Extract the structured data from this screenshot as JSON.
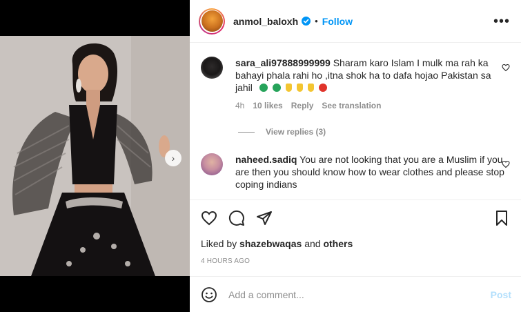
{
  "post": {
    "username": "anmol_baloxh",
    "separator": "•",
    "follow_label": "Follow",
    "more_icon": "more-horizontal-icon",
    "carousel": {
      "slide_count": 2,
      "active_index": 0
    }
  },
  "comments": [
    {
      "username": "sara_ali97888999999",
      "text": "Sharam karo Islam I mulk ma rah ka bahayi phala rahi ho ,itna shok ha to dafa hojao Pakistan sa jahil",
      "time": "4h",
      "likes": "10 likes",
      "reply": "Reply",
      "translate": "See translation",
      "view_replies": "View replies (3)"
    },
    {
      "username": "naheed.sadiq",
      "text": "You are not looking that you are a Muslim if you are then you should know how to wear clothes and please stop coping indians"
    }
  ],
  "footer": {
    "liked_by_prefix": "Liked by",
    "liked_by_user": "shazebwaqas",
    "liked_by_and": "and",
    "liked_by_others": "others",
    "timestamp": "4 HOURS AGO",
    "comment_placeholder": "Add a comment...",
    "post_label": "Post"
  },
  "colors": {
    "accent": "#0095f6",
    "post_disabled": "#b2dffc",
    "muted": "#8e8e8e"
  }
}
